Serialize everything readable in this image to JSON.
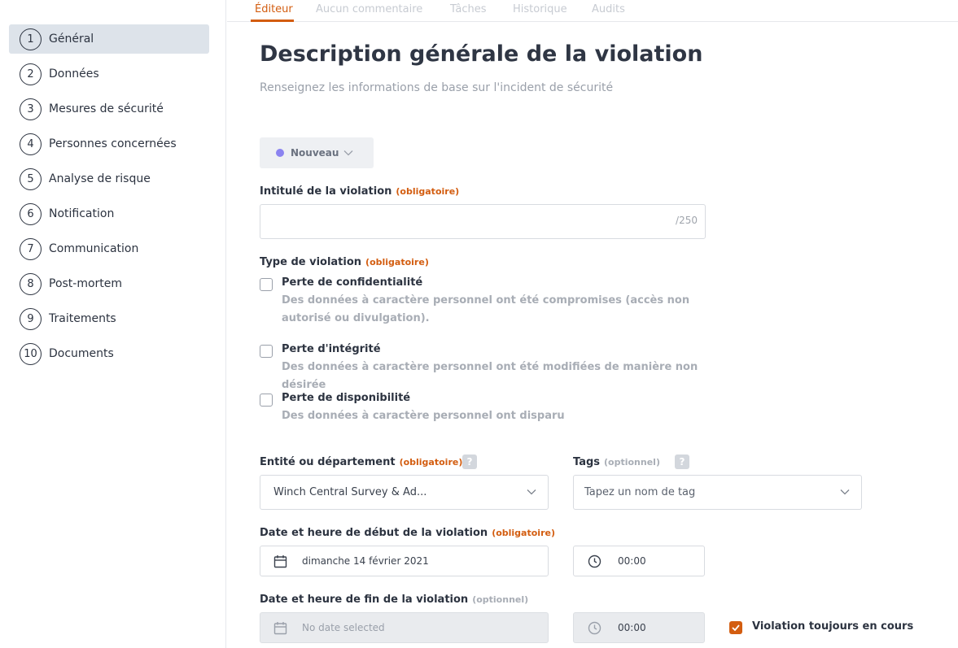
{
  "sidebar": {
    "items": [
      {
        "num": "1",
        "label": "Général"
      },
      {
        "num": "2",
        "label": "Données"
      },
      {
        "num": "3",
        "label": "Mesures de sécurité"
      },
      {
        "num": "4",
        "label": "Personnes concernées"
      },
      {
        "num": "5",
        "label": "Analyse de risque"
      },
      {
        "num": "6",
        "label": "Notification"
      },
      {
        "num": "7",
        "label": "Communication"
      },
      {
        "num": "8",
        "label": "Post-mortem"
      },
      {
        "num": "9",
        "label": "Traitements"
      },
      {
        "num": "10",
        "label": "Documents"
      }
    ]
  },
  "tabs": [
    "Éditeur",
    "Aucun commentaire",
    "Tâches",
    "Historique",
    "Audits"
  ],
  "page": {
    "title": "Description générale de la violation",
    "subtitle": "Renseignez les informations de base sur l'incident de sécurité"
  },
  "status": {
    "label": "Nouveau",
    "color": "#8b83f0"
  },
  "tags_text": {
    "required": "(obligatoire)",
    "optional": "(optionnel)",
    "help": "?"
  },
  "breach_title": {
    "label": "Intitulé de la violation",
    "value": "",
    "counter": "/250"
  },
  "breach_type": {
    "label": "Type de violation",
    "options": [
      {
        "title": "Perte de confidentialité",
        "desc": "Des données à caractère personnel ont été compromises (accès non autorisé ou divulgation).",
        "checked": false
      },
      {
        "title": "Perte d'intégrité",
        "desc": "Des données à caractère personnel ont été modifiées de manière non désirée",
        "checked": false
      },
      {
        "title": "Perte de disponibilité",
        "desc": "Des données à caractère personnel ont disparu",
        "checked": false
      }
    ]
  },
  "entity": {
    "label": "Entité ou département",
    "value": "Winch Central Survey & Ad..."
  },
  "tags": {
    "label": "Tags",
    "placeholder": "Tapez un nom de tag"
  },
  "start": {
    "label": "Date et heure de début de la violation",
    "date": "dimanche 14 février 2021",
    "time": "00:00"
  },
  "end": {
    "label": "Date et heure de fin de la violation",
    "date": "No date selected",
    "time": "00:00"
  },
  "ongoing": {
    "label": "Violation toujours en cours",
    "checked": true
  },
  "colors": {
    "accent": "#d35d10",
    "active_bg": "#dde3ea"
  }
}
